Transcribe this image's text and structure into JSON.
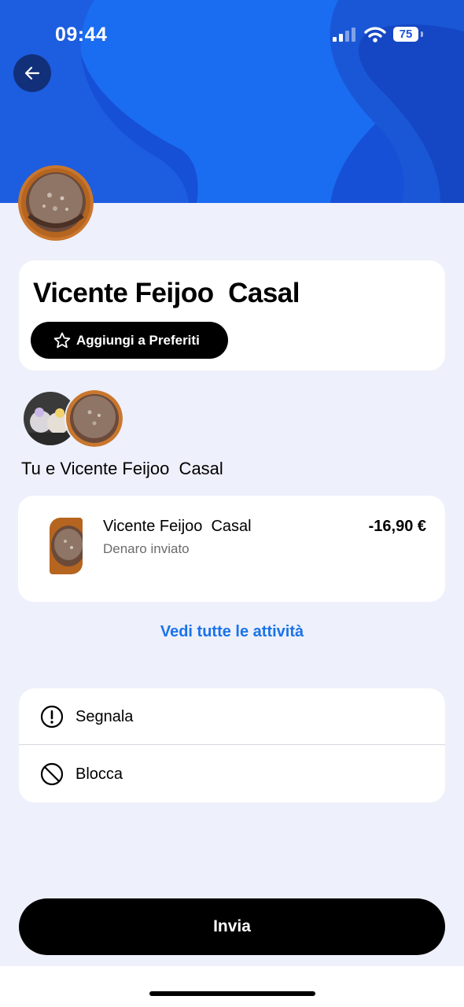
{
  "status_bar": {
    "time": "09:44",
    "battery": "75"
  },
  "profile": {
    "name": "Vicente Feijoo  Casal",
    "favorite_label": "Aggiungi a Preferiti",
    "together_label": "Tu e Vicente Feijoo  Casal"
  },
  "transaction": {
    "name": "Vicente Feijoo  Casal",
    "type": "Denaro inviato",
    "amount": "-16,90 €"
  },
  "see_all_label": "Vedi tutte le attività",
  "menu": [
    {
      "label": "Segnala",
      "icon": "alert-circle-icon"
    },
    {
      "label": "Blocca",
      "icon": "block-icon"
    }
  ],
  "send_label": "Invia",
  "colors": {
    "header": "#1a56db",
    "link": "#1a73e8",
    "background": "#eef0fb"
  }
}
